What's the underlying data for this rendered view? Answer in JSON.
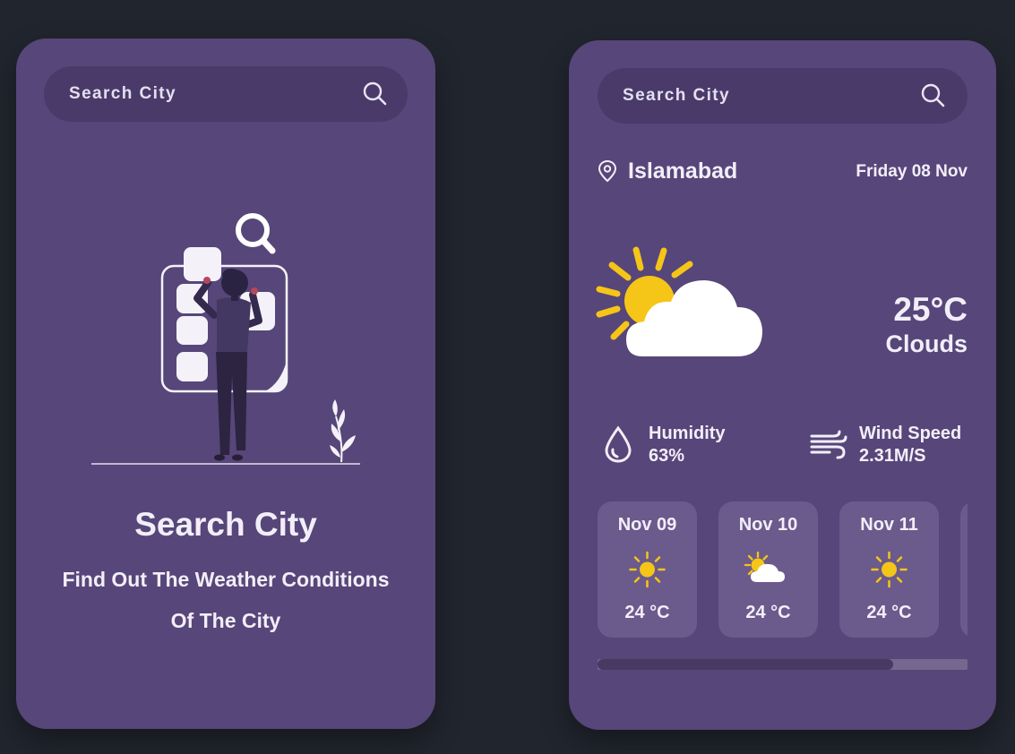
{
  "empty_panel": {
    "search_placeholder": "Search City",
    "title": "Search City",
    "subtitle_line1": "Find Out The Weather Conditions",
    "subtitle_line2": "Of The City"
  },
  "weather_panel": {
    "search_placeholder": "Search City",
    "city": "Islamabad",
    "date": "Friday 08 Nov",
    "temperature": "25°C",
    "condition": "Clouds",
    "condition_icon": "sun-behind-cloud-icon",
    "humidity_label": "Humidity",
    "humidity_value": "63%",
    "wind_label": "Wind Speed",
    "wind_value": "2.31M/S",
    "forecast": [
      {
        "date": "Nov 09",
        "icon": "sun-icon",
        "temp": "24 °C"
      },
      {
        "date": "Nov 10",
        "icon": "partly-cloudy-icon",
        "temp": "24 °C"
      },
      {
        "date": "Nov 11",
        "icon": "sun-icon",
        "temp": "24 °C"
      }
    ],
    "forecast_scroll_position": 0.8
  },
  "colors": {
    "background": "#21252e",
    "card": "#574679",
    "search_bar": "#4a3a69",
    "forecast_card": "#6b5a8c",
    "sun": "#f5c518",
    "text": "#f2eef8"
  }
}
